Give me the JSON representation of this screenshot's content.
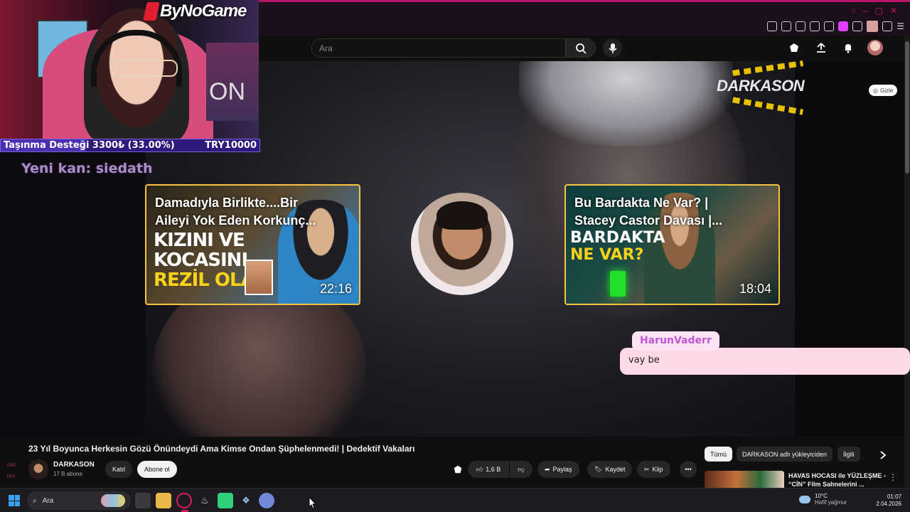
{
  "brand": {
    "name": "ByNoGame"
  },
  "overlay": {
    "donation_label": "Taşınma Desteği 3300₺ (33.00%)",
    "donation_goal": "TRY10000",
    "donation_progress": 0.33,
    "new_subscriber": "Yeni kan: siedath",
    "webcam_poster_text": "ON"
  },
  "search": {
    "placeholder": "Ara"
  },
  "video": {
    "watermark": "DARKASON",
    "hide_label": "Gizle",
    "cards": [
      {
        "title": "Damadıyla Birlikte....Bir\nAileyi Yok Eden Korkunç...",
        "duration": "22:16",
        "thumb_lines": [
          "KIZINI VE",
          "KOCASINI...",
          "REZİL OLAY"
        ]
      },
      {
        "title": "Bu Bardakta Ne Var? |\nStacey Castor Davası |...",
        "duration": "18:04",
        "thumb_lines": [
          "BARDAKTA",
          "NE VAR?"
        ]
      }
    ]
  },
  "chat": {
    "user": "HarunVaderr",
    "message": "vay be"
  },
  "details": {
    "title": "23 Yıl Boyunca Herkesin Gözü Önündeydi Ama Kimse Ondan Şüphelenmedi! | Dedektif Vakaları",
    "channel": "DARKASON",
    "subscribers": "17 B abone",
    "join_label": "Katıl",
    "subscribe_label": "Abone ol",
    "likes": "1,6 B",
    "share_label": "Paylaş",
    "save_label": "Kaydet",
    "clip_label": "Klip"
  },
  "filters": {
    "chips": [
      "Tümü",
      "DARKASON adlı yükleyiciden",
      "İlgili"
    ]
  },
  "recommended": {
    "title": "HAVAS HOCASI ile YÜZLEŞME -\n“CİN” Film Sahnelerini ..."
  },
  "left_strip": [
    "GEK",
    "FEX"
  ],
  "taskbar": {
    "search_label": "Ara",
    "weather_temp": "10°C",
    "weather_desc": "Hafif yağmur",
    "time": "01:07",
    "date": "2.04.2026"
  },
  "colors": {
    "accent_pink": "#b8146a",
    "chat_bubble": "#ffd9e8",
    "chat_user": "#c356d6",
    "donation_bar": "#2d1a7a",
    "card_border": "#f5c542"
  }
}
